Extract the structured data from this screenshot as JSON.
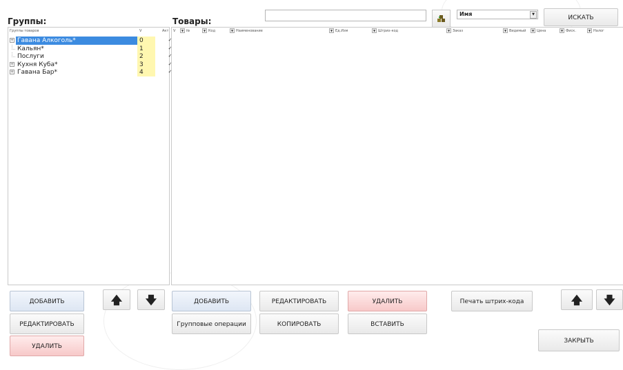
{
  "groups": {
    "title": "Группы:",
    "columns": {
      "name": "Группы товаров",
      "v": "V",
      "act": "Акт"
    },
    "rows": [
      {
        "name": "Гавана Алкоголь*",
        "v": "0",
        "act": "✓",
        "expandable": true,
        "selected": true
      },
      {
        "name": "Кальян*",
        "v": "1",
        "act": "✓",
        "expandable": false,
        "selected": false
      },
      {
        "name": "Послуги",
        "v": "2",
        "act": "✓",
        "expandable": false,
        "selected": false
      },
      {
        "name": "Кухня Куба*",
        "v": "3",
        "act": "✓",
        "expandable": true,
        "selected": false
      },
      {
        "name": "Гавана Бар*",
        "v": "4",
        "act": "✓",
        "expandable": true,
        "selected": false
      }
    ]
  },
  "products": {
    "title": "Товары:",
    "columns": [
      "V",
      "№",
      "Код",
      "Наименование",
      "Ед.Изм",
      "Штрих-код",
      "Заказ",
      "Видимый",
      "Цена",
      "Фиск.",
      "Налог"
    ]
  },
  "search": {
    "value": "",
    "field_select": "Имя",
    "button": "ИСКАТЬ"
  },
  "left_buttons": {
    "add": "ДОБАВИТЬ",
    "edit": "РЕДАКТИРОВАТЬ",
    "delete": "УДАЛИТЬ",
    "up": "🡅",
    "down": "🡇"
  },
  "right_buttons": {
    "add": "ДОБАВИТЬ",
    "edit": "РЕДАКТИРОВАТЬ",
    "delete": "УДАЛИТЬ",
    "print_barcode": "Печать штрих-кода",
    "group_ops": "Групповые операции",
    "copy": "КОПИРОВАТЬ",
    "paste": "ВСТАВИТЬ",
    "close": "ЗАКРЫТЬ",
    "up": "🡅",
    "down": "🡇"
  },
  "icons": {
    "barcode_search": "barcode-search-icon"
  },
  "colors": {
    "selected": "#3c8be0",
    "v_cell": "#fff7b0",
    "delete_button": "#f7c9c9",
    "add_button": "#dde6f3"
  }
}
